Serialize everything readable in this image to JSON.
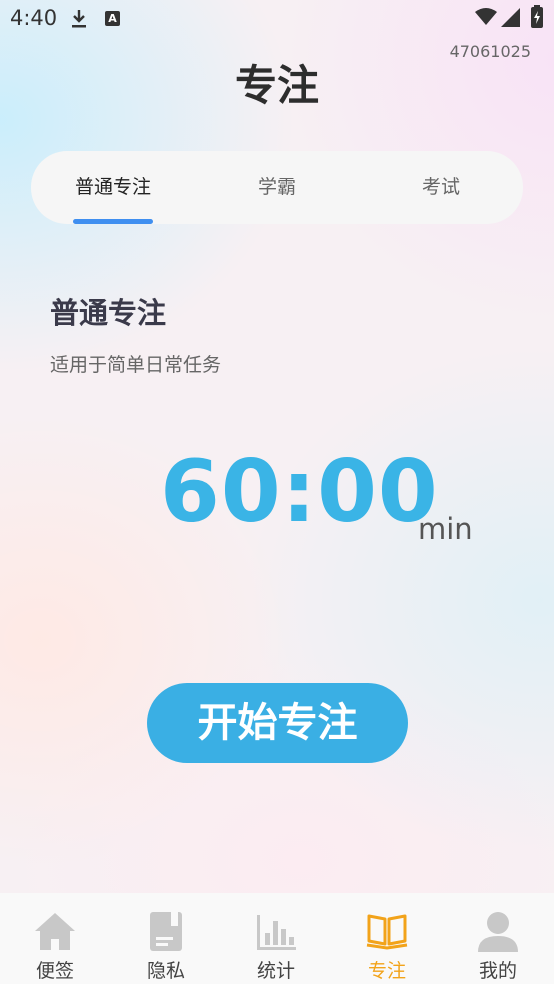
{
  "status_bar": {
    "time": "4:40",
    "notification_letter": "A"
  },
  "device_id": "47061025",
  "page_title": "专注",
  "tabs": [
    {
      "label": "普通专注",
      "active": true
    },
    {
      "label": "学霸",
      "active": false
    },
    {
      "label": "考试",
      "active": false
    }
  ],
  "mode": {
    "title": "普通专注",
    "description": "适用于简单日常任务"
  },
  "timer": {
    "value": "60:00",
    "unit": "min"
  },
  "start_button_label": "开始专注",
  "bottom_nav": [
    {
      "label": "便签",
      "icon": "home-icon",
      "active": false
    },
    {
      "label": "隐私",
      "icon": "notebook-icon",
      "active": false
    },
    {
      "label": "统计",
      "icon": "bar-chart-icon",
      "active": false
    },
    {
      "label": "专注",
      "icon": "open-book-icon",
      "active": true
    },
    {
      "label": "我的",
      "icon": "person-icon",
      "active": false
    }
  ],
  "colors": {
    "accent_blue": "#3ab4e6",
    "tab_indicator": "#3f8ff0",
    "nav_active": "#f2a31a",
    "nav_inactive_icon": "#c8c8c8"
  }
}
